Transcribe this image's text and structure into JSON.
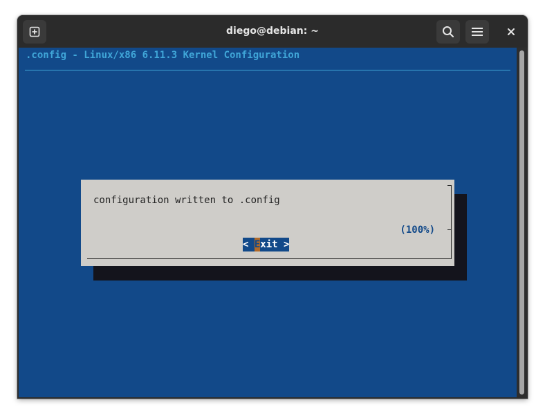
{
  "window": {
    "title": "diego@debian: ~"
  },
  "titlebar": {
    "new_tab_icon": "new-tab-icon",
    "search_icon": "search-icon",
    "menu_icon": "hamburger-menu-icon",
    "close_glyph": "✕"
  },
  "terminal": {
    "header": ".config - Linux/x86 6.11.3 Kernel Configuration",
    "colors": {
      "background": "#124989",
      "header_text": "#40a6d8",
      "dialog_bg": "#cfcdc9",
      "dialog_shadow": "#14141c",
      "hotkey": "#b06a2a"
    }
  },
  "dialog": {
    "message": "configuration written to .config",
    "percent": "(100%)",
    "button": {
      "left_bracket": "< ",
      "hotkey": "E",
      "rest": "xit",
      "right_bracket": " >"
    }
  }
}
